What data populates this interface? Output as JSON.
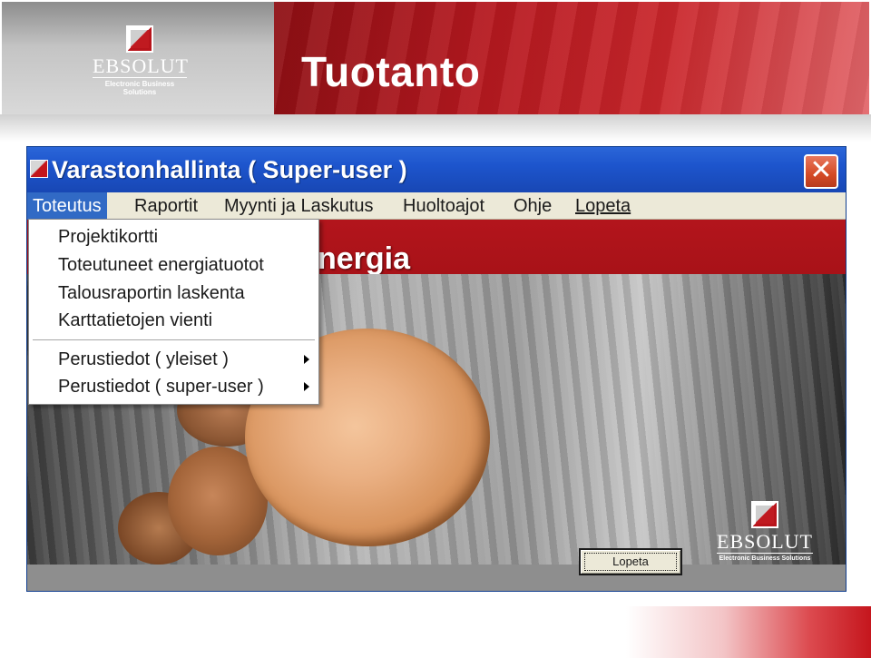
{
  "slide": {
    "title": "Tuotanto",
    "brand_name": "EBSOLUT",
    "brand_tagline": "Electronic Business Solutions"
  },
  "window": {
    "title": "Varastonhallinta  ( Super-user )",
    "close_glyph": "✕"
  },
  "menubar": {
    "items": [
      {
        "label": "Toteutus"
      },
      {
        "label": "Raportit"
      },
      {
        "label": "Myynti ja Laskutus"
      },
      {
        "label": "Huoltoajot"
      },
      {
        "label": "Ohje"
      },
      {
        "label": "Lopeta"
      }
    ]
  },
  "dropdown": {
    "items": [
      {
        "label": "Projektikortti"
      },
      {
        "label": "Toteutuneet energiatuotot"
      },
      {
        "label": "Talousraportin laskenta"
      },
      {
        "label": "Karttatietojen vienti"
      },
      {
        "label": "Perustiedot ( yleiset )"
      },
      {
        "label": "Perustiedot ( super-user )"
      }
    ]
  },
  "content": {
    "banner_text": "nergia",
    "lopeta_button": "Lopeta",
    "brand_name": "EBSOLUT",
    "brand_tagline": "Electronic Business Solutions"
  },
  "colors": {
    "brand_red": "#b3151c",
    "titlebar_blue": "#1d55cd",
    "menu_highlight": "#316ac5"
  },
  "icons": [
    "ebsolut-logo-icon",
    "app-icon",
    "close-icon",
    "submenu-arrow-icon"
  ]
}
